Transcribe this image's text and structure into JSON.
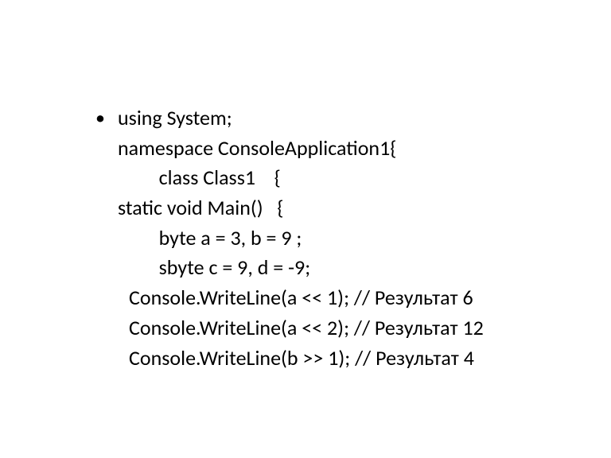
{
  "code": {
    "lines": [
      "using System;",
      "namespace ConsoleApplication1{",
      "   class Class1    {",
      "static void Main()   {",
      "   byte a = 3, b = 9 ;",
      "   sbyte c = 9, d = -9;",
      "Console.WriteLine(a << 1); // Результат 6",
      "Console.WriteLine(a << 2); // Результат 12",
      "Console.WriteLine(b >> 1); // Результат 4"
    ]
  },
  "bullet": "•"
}
